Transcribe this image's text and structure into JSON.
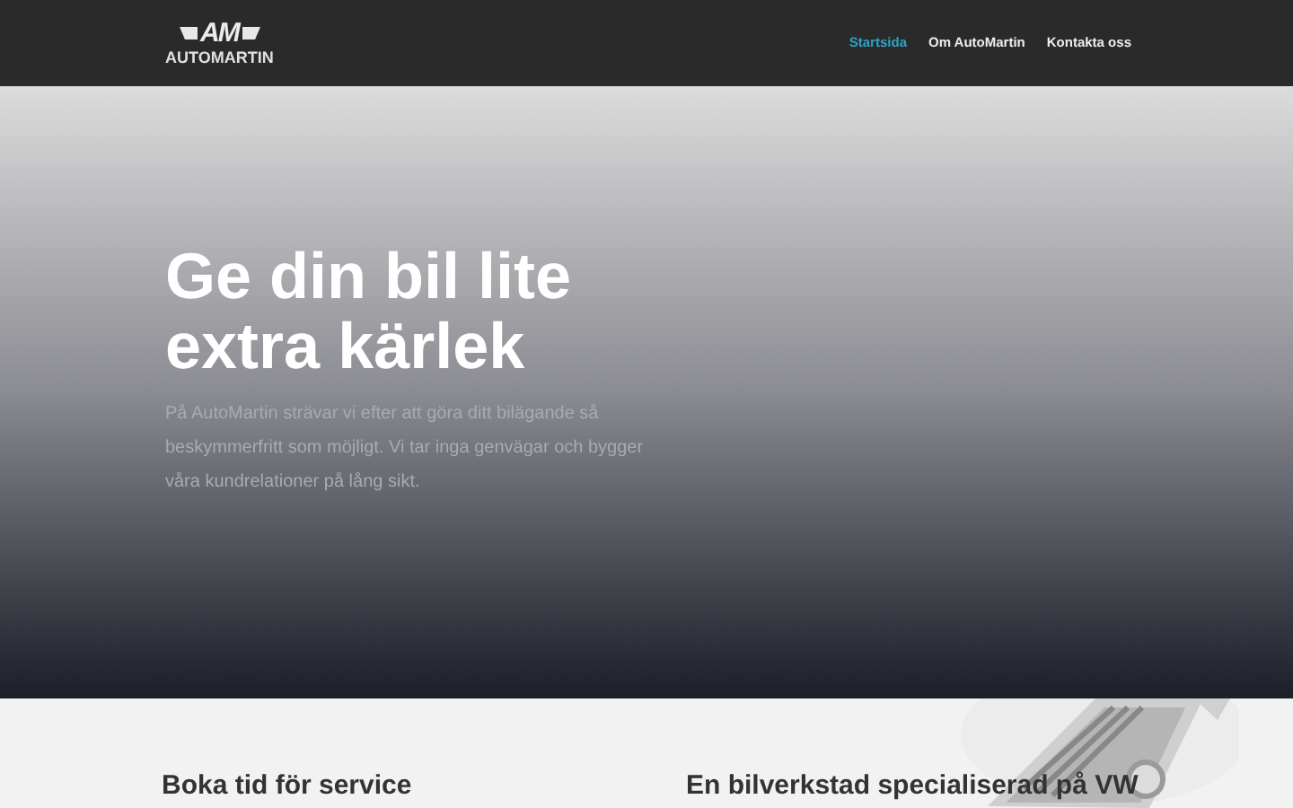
{
  "header": {
    "logo_mark": "AM",
    "logo_text": "AUTOMARTIN",
    "nav": [
      {
        "label": "Startsida",
        "selected": true
      },
      {
        "label": "Om AutoMartin",
        "selected": false
      },
      {
        "label": "Kontakta oss",
        "selected": false
      }
    ]
  },
  "hero": {
    "title": "Ge din bil lite extra kärlek",
    "text": "På AutoMartin strävar vi efter att göra ditt bilägande så beskymmerfritt som möjligt. Vi tar inga genvägar och bygger våra kundrelationer på lång sikt."
  },
  "section": {
    "headings": [
      "Boka tid för service",
      "En bilverkstad specialiserad på VW"
    ]
  }
}
